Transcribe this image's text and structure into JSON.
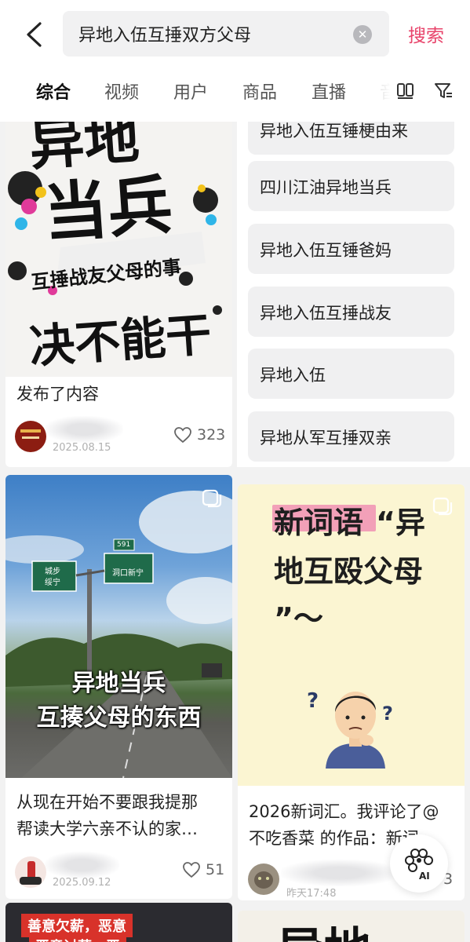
{
  "search": {
    "query": "异地入伍互捶双方父母",
    "button_label": "搜索"
  },
  "tabs": [
    "综合",
    "视频",
    "用户",
    "商品",
    "直播",
    "音"
  ],
  "suggestions": [
    "异地入伍互锤梗由来",
    "四川江油异地当兵",
    "异地入伍互锤爸妈",
    "异地入伍互捶战友",
    "异地入伍",
    "异地从军互捶双亲"
  ],
  "cards": {
    "card1": {
      "image_text": [
        "异地",
        "当兵",
        "互捶战友父母的事",
        "决不能干"
      ],
      "title": "发布了内容",
      "date": "2025.08.15",
      "likes": "323"
    },
    "card2": {
      "image_text": [
        "异地当兵",
        "互揍父母的东西"
      ],
      "sign_text": [
        "城步",
        "绥宁",
        "591",
        "洞口新宁"
      ],
      "title_line1": "从现在开始不要跟我提那",
      "title_line2": "帮读大学六亲不认的家…",
      "date": "2025.09.12",
      "likes": "51"
    },
    "card3": {
      "image_text": [
        "新词语",
        "“异",
        "地互殴父母",
        "”～"
      ],
      "title_line1": "2026新词汇。我评论了@",
      "title_line2": "不吃香菜 的作品：新词…",
      "date": "昨天17:48",
      "likes": "3"
    },
    "card4": {
      "image_text": [
        "善意欠薪，恶意",
        "恶意讨薪，恶"
      ]
    },
    "card5": {
      "image_text": [
        "异地"
      ]
    }
  },
  "ai_label": "AI",
  "colors": {
    "accent": "#e8436a",
    "card3_bg": "#fbf5d2",
    "highlight": "#f2a0b8"
  }
}
